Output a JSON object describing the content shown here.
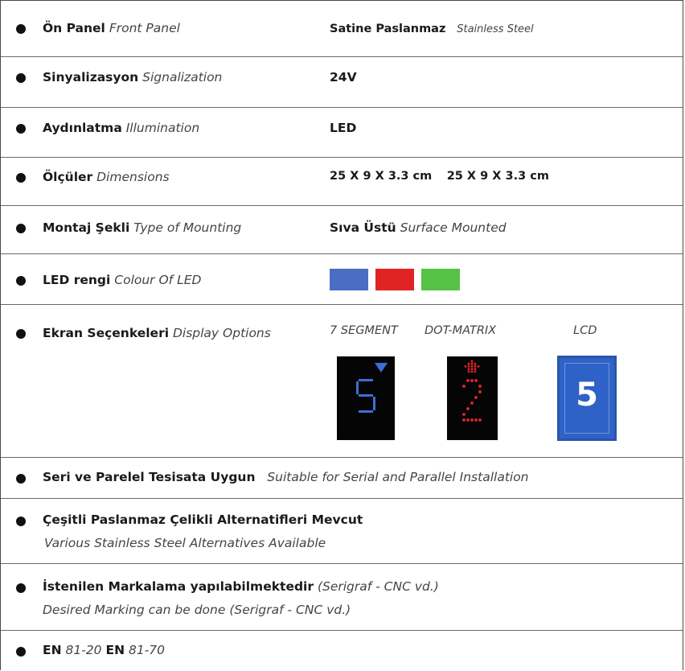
{
  "rows": [
    {
      "label_tr": "Ön Panel",
      "label_en": "Front Panel",
      "value_bold": "Satine Paslanmaz",
      "value_italic": "Stainless Steel"
    },
    {
      "label_tr": "Sinyalizasyon",
      "label_en": "Signalization",
      "value_bold": "24V"
    },
    {
      "label_tr": "Aydınlatma",
      "label_en": "Illumination",
      "value_bold": "LED"
    },
    {
      "label_tr": "Ölçüler",
      "label_en": "Dimensions",
      "value_bold": "25 X 9 X 3.3 cm",
      "value_bold2": "25 X 9 X 3.3 cm"
    },
    {
      "label_tr": "Montaj Şekli",
      "label_en": "Type of Mounting",
      "value_bold": "Sıva Üstü",
      "value_italic": "Surface Mounted"
    },
    {
      "label_tr": "LED rengi",
      "label_en": "Colour Of LED"
    },
    {
      "label_tr": "Ekran Seçenkeleri",
      "label_en": "Display Options"
    }
  ],
  "led_colors": [
    "#4a6ec2",
    "#e02424",
    "#55c245"
  ],
  "display_options": [
    {
      "label": "7 SEGMENT",
      "digit": "5",
      "color": "#3b6fd6",
      "icon": "arrow-down-icon"
    },
    {
      "label": "DOT-MATRIX",
      "digit": "2",
      "color": "#e8242a",
      "icon": "arrow-up-icon"
    },
    {
      "label": "LCD",
      "digit": "5",
      "color": "#2f62c6"
    }
  ],
  "features": [
    {
      "bold": "Seri ve Parelel Tesisata Uygun",
      "italic": "Suitable for Serial and Parallel Installation"
    },
    {
      "bold": "Çeşitli Paslanmaz Çelikli Alternatifleri Mevcut",
      "italic": "Various Stainless Steel Alternatives Available"
    },
    {
      "bold": "İstenilen Markalama yapılabilmektedir",
      "italic": "(Serigraf - CNC vd.)",
      "italic2": "Desired Marking can be done (Serigraf - CNC vd.)"
    }
  ],
  "standards": {
    "en1": "EN",
    "num1": "81-20",
    "en2": "EN",
    "num2": "81-70"
  }
}
